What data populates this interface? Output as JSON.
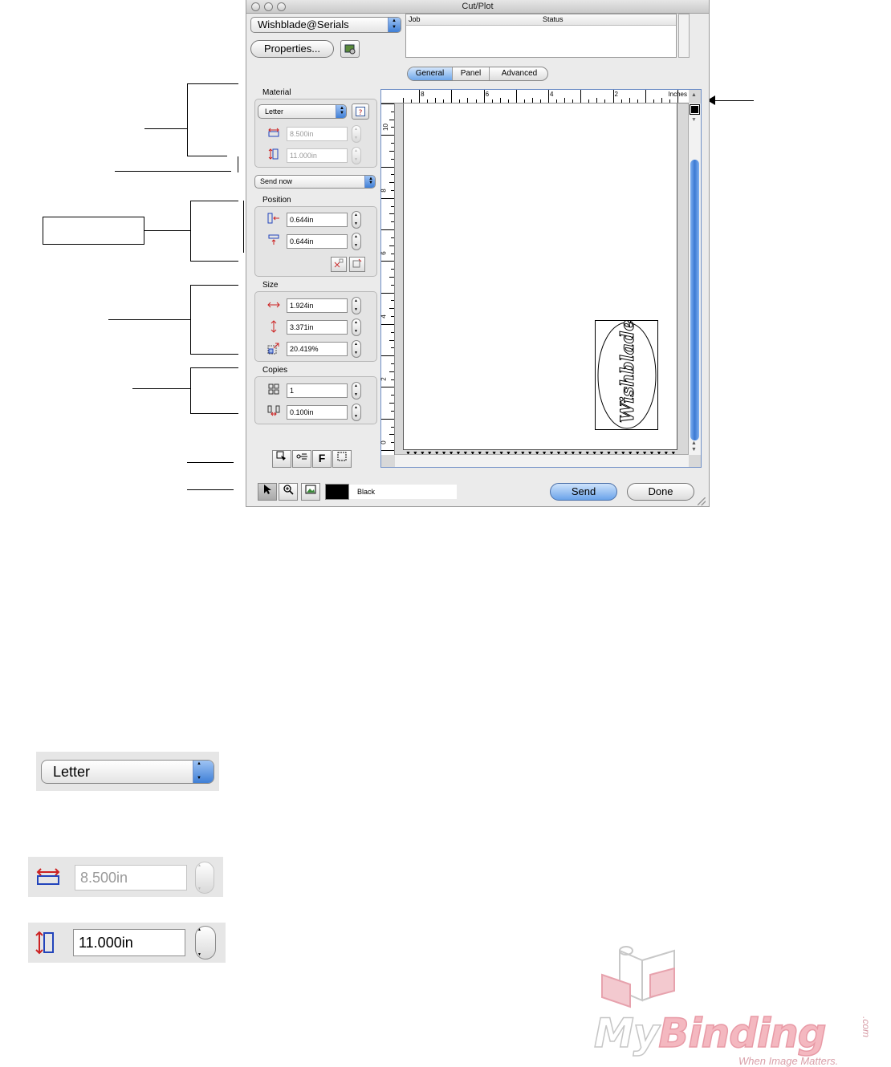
{
  "window": {
    "title": "Cut/Plot"
  },
  "toolbar": {
    "device": "Wishblade@Serials",
    "properties_label": "Properties...",
    "icons": [
      "device-settings-icon"
    ]
  },
  "job_list": {
    "columns": [
      "Job",
      "Status"
    ],
    "rows": []
  },
  "tabs": [
    {
      "label": "General",
      "selected": true
    },
    {
      "label": "Panel",
      "selected": false
    },
    {
      "label": "Advanced",
      "selected": false
    }
  ],
  "material": {
    "label": "Material",
    "preset": "Letter",
    "width": "8.500in",
    "height": "11.000in"
  },
  "send_mode": "Send now",
  "position": {
    "label": "Position",
    "x": "0.644in",
    "y": "0.644in"
  },
  "size": {
    "label": "Size",
    "width": "1.924in",
    "height": "3.371in",
    "scale": "20.419%"
  },
  "copies": {
    "label": "Copies",
    "count": "1",
    "spacing": "0.100in"
  },
  "preview": {
    "units": "Inches",
    "top_ruler": [
      "8",
      "6",
      "4",
      "2"
    ],
    "left_ruler": [
      "10",
      "8",
      "6",
      "4",
      "2",
      "0"
    ],
    "artwork_text": "Wishblade"
  },
  "bottom": {
    "color_name": "Black",
    "swatch_color": "#000000",
    "send_label": "Send",
    "done_label": "Done"
  },
  "zoomed": {
    "preset": "Letter",
    "width": "8.500in",
    "height": "11.000in"
  },
  "logo": {
    "brand": "MyBinding",
    "suffix": ".com",
    "tagline": "When Image Matters."
  }
}
